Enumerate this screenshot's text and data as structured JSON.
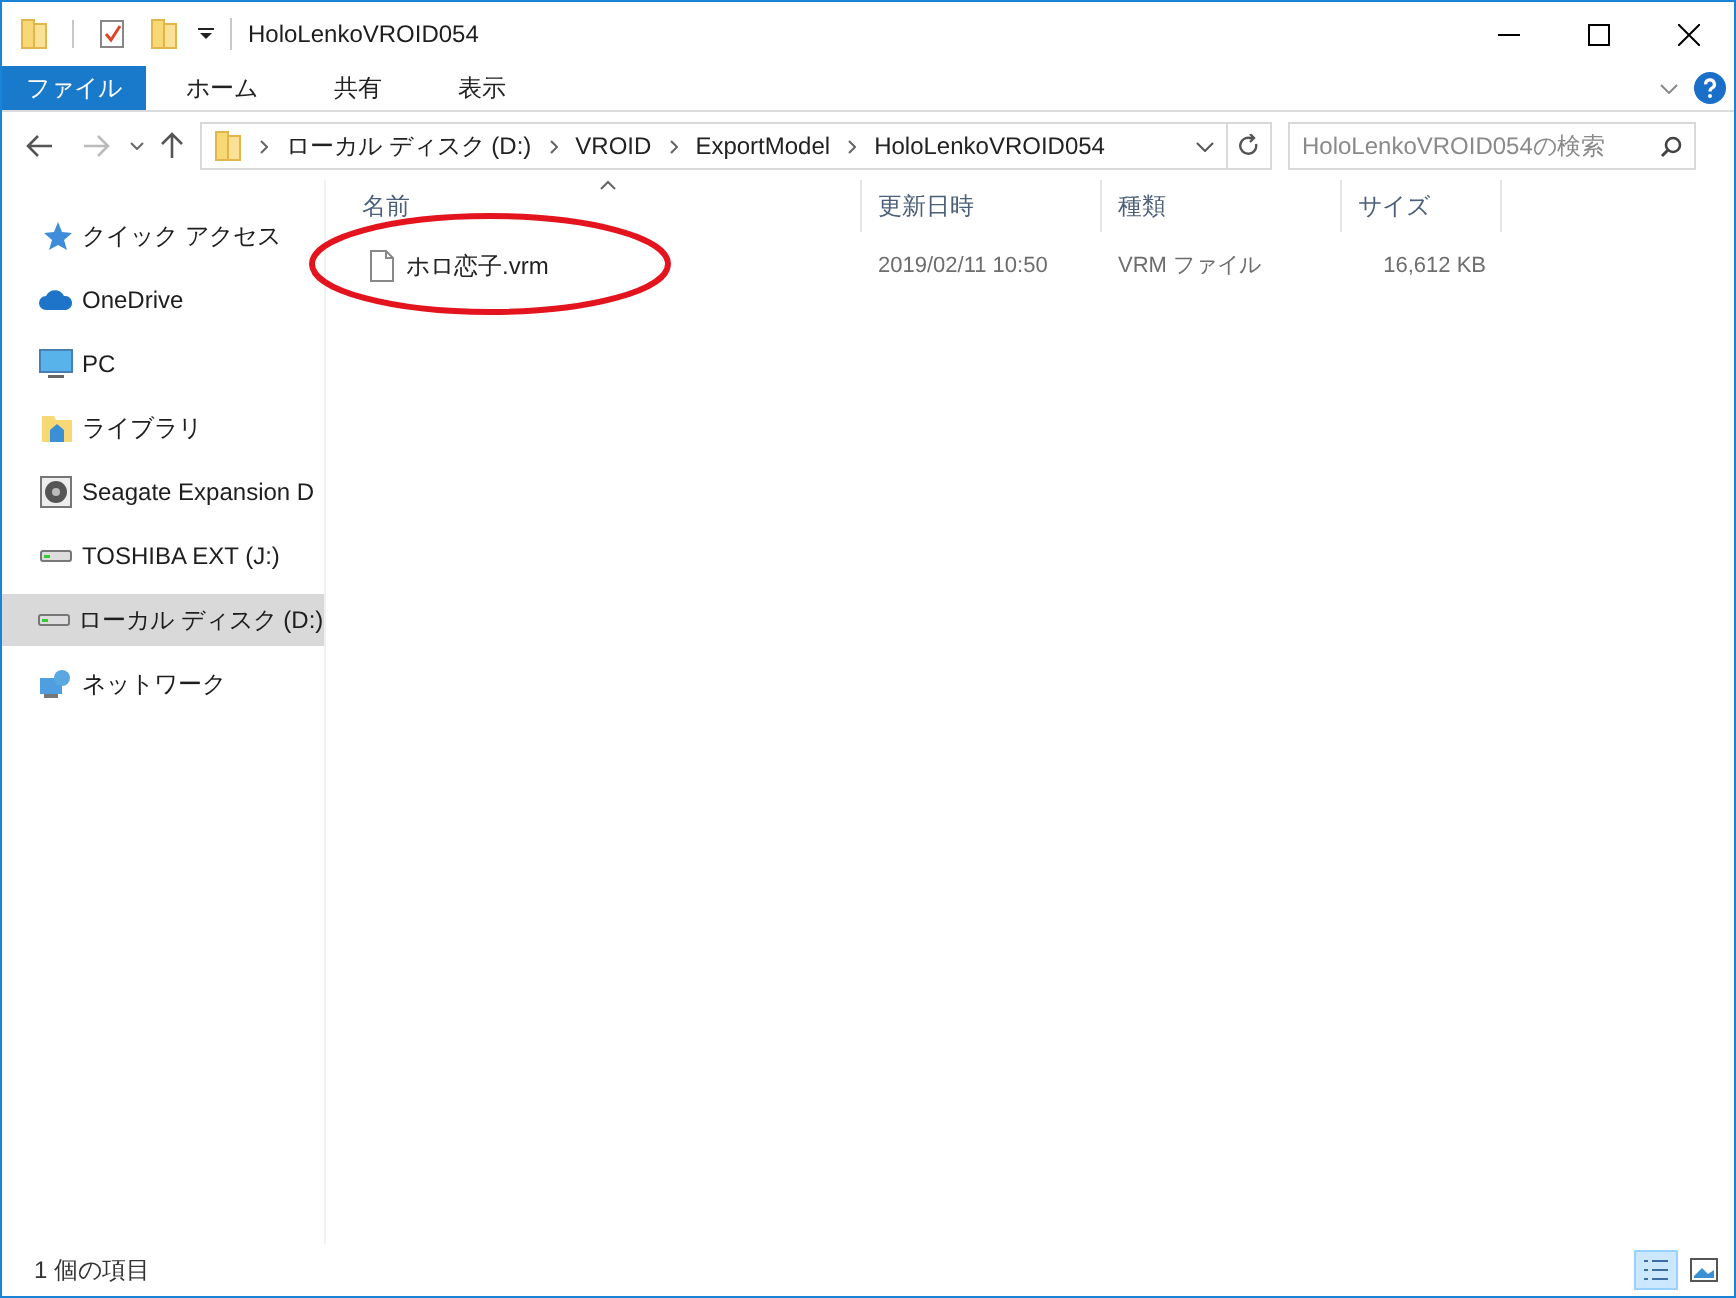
{
  "window": {
    "title": "HoloLenkoVROID054"
  },
  "ribbon_tabs": [
    {
      "label": "ファイル",
      "selected": true
    },
    {
      "label": "ホーム",
      "selected": false
    },
    {
      "label": "共有",
      "selected": false
    },
    {
      "label": "表示",
      "selected": false
    }
  ],
  "address": {
    "segments": [
      "ローカル ディスク (D:)",
      "VROID",
      "ExportModel",
      "HoloLenkoVROID054"
    ]
  },
  "search": {
    "placeholder": "HoloLenkoVROID054の検索"
  },
  "sidebar": {
    "items": [
      {
        "label": "クイック アクセス",
        "kind": "star",
        "selected": false
      },
      {
        "label": "OneDrive",
        "kind": "cloud",
        "selected": false
      },
      {
        "label": "PC",
        "kind": "monitor",
        "selected": false
      },
      {
        "label": "ライブラリ",
        "kind": "library",
        "selected": false
      },
      {
        "label": "Seagate Expansion D",
        "kind": "disk",
        "selected": false
      },
      {
        "label": "TOSHIBA EXT (J:)",
        "kind": "drive",
        "selected": false
      },
      {
        "label": "ローカル ディスク (D:)",
        "kind": "drive",
        "selected": true
      },
      {
        "label": "ネットワーク",
        "kind": "network",
        "selected": false
      }
    ]
  },
  "table": {
    "columns": [
      "名前",
      "更新日時",
      "種類",
      "サイズ"
    ],
    "rows": [
      {
        "name": "ホロ恋子.vrm",
        "modified": "2019/02/11 10:50",
        "type": "VRM ファイル",
        "size": "16,612 KB",
        "circled": true
      }
    ]
  },
  "status_bar": {
    "text": "1 個の項目",
    "views": [
      {
        "kind": "details",
        "selected": true
      },
      {
        "kind": "large-icons",
        "selected": false
      }
    ]
  }
}
